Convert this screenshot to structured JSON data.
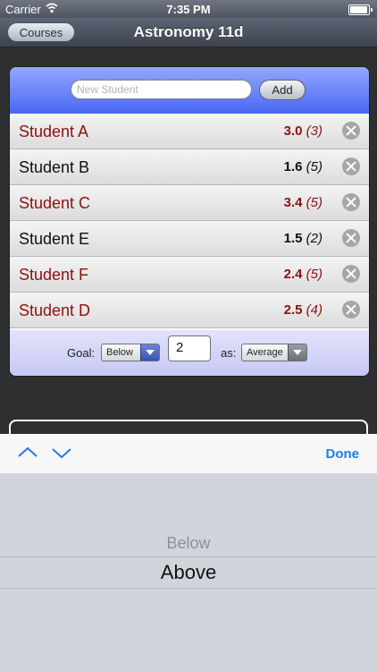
{
  "status": {
    "carrier": "Carrier",
    "time": "7:35 PM",
    "battery_level": 0.95
  },
  "nav": {
    "back_label": "Courses",
    "title": "Astronomy 11d"
  },
  "form": {
    "new_student_placeholder": "New Student",
    "add_label": "Add"
  },
  "students": [
    {
      "name": "Student A",
      "average": "3.0",
      "count": "(3)"
    },
    {
      "name": "Student B",
      "average": "1.6",
      "count": "(5)"
    },
    {
      "name": "Student C",
      "average": "3.4",
      "count": "(5)"
    },
    {
      "name": "Student E",
      "average": "1.5",
      "count": "(2)"
    },
    {
      "name": "Student F",
      "average": "2.4",
      "count": "(5)"
    },
    {
      "name": "Student D",
      "average": "2.5",
      "count": "(4)"
    }
  ],
  "goal": {
    "label": "Goal:",
    "direction": "Below",
    "value": "2",
    "as_label": "as:",
    "mode": "Average"
  },
  "accessory": {
    "done_label": "Done"
  },
  "picker": {
    "options": [
      "Below",
      "Above"
    ]
  },
  "colors": {
    "header_blue": "#4a67f1",
    "red_text": "#8c1111",
    "done_blue": "#1f7de5"
  }
}
